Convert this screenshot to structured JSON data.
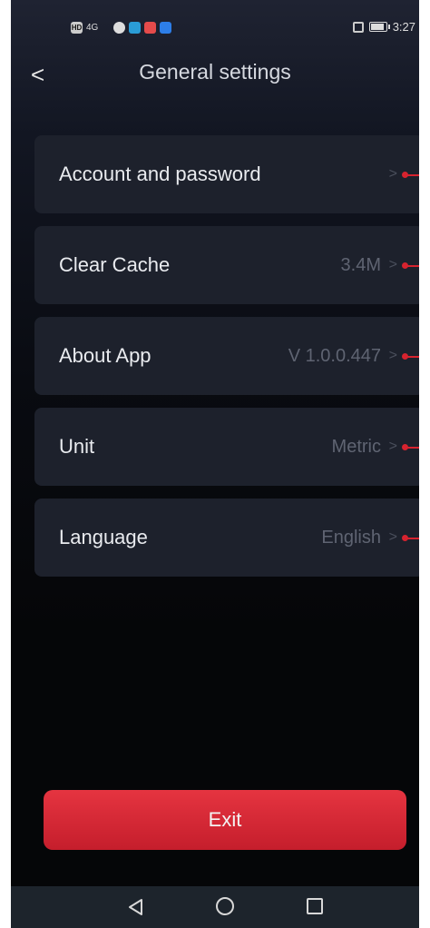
{
  "status_bar": {
    "network": "4G",
    "time": "3:27",
    "icons": [
      "hd-icon",
      "signal-icon",
      "app-icon",
      "app-icon",
      "app-icon",
      "app-icon",
      "vibrate-icon",
      "battery-icon"
    ]
  },
  "header": {
    "back_glyph": "<",
    "title": "General settings"
  },
  "settings": [
    {
      "label": "Account and password",
      "value": ""
    },
    {
      "label": "Clear Cache",
      "value": "3.4M"
    },
    {
      "label": "About App",
      "value": "V 1.0.0.447"
    },
    {
      "label": "Unit",
      "value": "Metric"
    },
    {
      "label": "Language",
      "value": "English"
    }
  ],
  "chevron_glyph": ">",
  "exit_label": "Exit",
  "colors": {
    "accent": "#d6232f",
    "card": "#1d212c",
    "background": "#090b11"
  }
}
